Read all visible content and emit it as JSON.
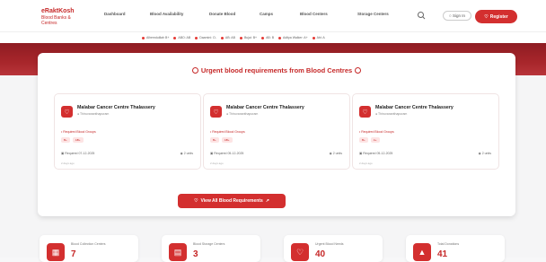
{
  "nav": {
    "logo_line1": "eRaktKosh",
    "logo_line2": "Blood Banks & Centres",
    "links": [
      "Dashboard",
      "Blood Availability",
      "Donate Blood",
      "Camps",
      "Blood Centers",
      "Storage Centers"
    ],
    "signin": "Sign In",
    "register": "Register"
  },
  "ticker": [
    "Alhemdulilah B+",
    "ABO: AB",
    "Daamini: O-",
    "AB: AB",
    "Bujai: B+",
    "AB: B",
    "Aditya Walker: A+",
    "Abi: A"
  ],
  "panel": {
    "title": "Urgent blood requirements from Blood Centres",
    "cards": [
      {
        "name": "Malabar Cancer Centre Thalassery",
        "location": "Thiruvananthapuram",
        "req_label": "Required Blood Groups",
        "groups": [
          "B+",
          "AB+"
        ],
        "date": "Required 07-12-2025",
        "units": "2 units",
        "ago": "2 days ago"
      },
      {
        "name": "Malabar Cancer Centre Thalassery",
        "location": "Thiruvananthapuram",
        "req_label": "Required Blood Groups",
        "groups": [
          "B+",
          "AB+"
        ],
        "date": "Required 05-12-2025",
        "units": "2 units",
        "ago": "2 days ago"
      },
      {
        "name": "Malabar Cancer Centre Thalassery",
        "location": "Thiruvananthapuram",
        "req_label": "Required Blood Groups",
        "groups": [
          "B+",
          "A+"
        ],
        "date": "Required 05-12-2025",
        "units": "2 units",
        "ago": "2 days ago"
      }
    ],
    "view_all": "View All Blood Requirements"
  },
  "stats": [
    {
      "label": "Blood Collection Centers",
      "value": "7"
    },
    {
      "label": "Blood Storage Centers",
      "value": "3"
    },
    {
      "label": "Urgent Blood Needs",
      "value": "40"
    },
    {
      "label": "Total Donations",
      "value": "41"
    }
  ],
  "colors": {
    "accent": "#d32f2f",
    "band": "#a8262b"
  }
}
